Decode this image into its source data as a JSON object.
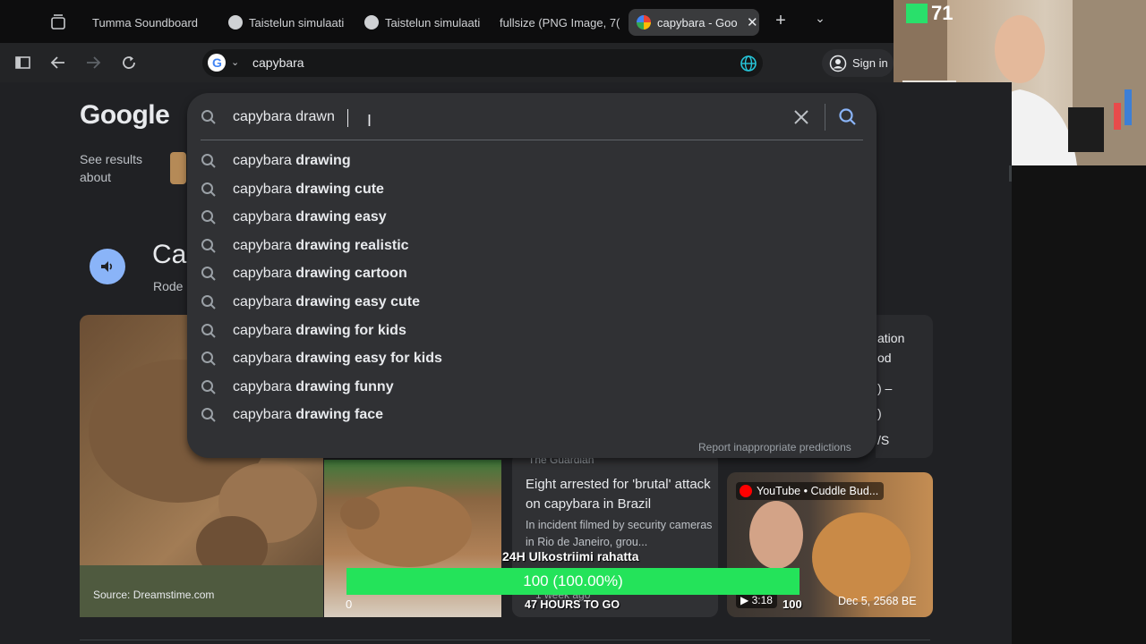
{
  "browser": {
    "tabs": [
      {
        "label": "Tumma Soundboard",
        "active": false
      },
      {
        "label": "Taistelun simulaati",
        "active": false
      },
      {
        "label": "Taistelun simulaati",
        "active": false
      },
      {
        "label": "fullsize (PNG Image, 7(",
        "active": false
      },
      {
        "label": "capybara - Goo",
        "active": true
      }
    ],
    "address": "capybara",
    "signin_label": "Sign in"
  },
  "webcam": {
    "score": "71"
  },
  "google": {
    "logo": "Google",
    "see_results": "See results about",
    "knowledge_title": "Ca",
    "knowledge_sub": "Rode",
    "search_query": "capybara drawn",
    "suggestions": [
      {
        "prefix": "capybara ",
        "bold": "drawing"
      },
      {
        "prefix": "capybara ",
        "bold": "drawing cute"
      },
      {
        "prefix": "capybara ",
        "bold": "drawing easy"
      },
      {
        "prefix": "capybara ",
        "bold": "drawing realistic"
      },
      {
        "prefix": "capybara ",
        "bold": "drawing cartoon"
      },
      {
        "prefix": "capybara ",
        "bold": "drawing easy cute"
      },
      {
        "prefix": "capybara ",
        "bold": "drawing for kids"
      },
      {
        "prefix": "capybara ",
        "bold": "drawing easy for kids"
      },
      {
        "prefix": "capybara ",
        "bold": "drawing funny"
      },
      {
        "prefix": "capybara ",
        "bold": "drawing face"
      }
    ],
    "report_label": "Report inappropriate predictions",
    "image_source": "Source: Dreamstime.com",
    "news": {
      "source": "The Guardian",
      "title": "Eight arrested for 'brutal' attack on capybara in Brazil",
      "description": "In incident filmed by security cameras in Rio de Janeiro, grou...",
      "age": "1 week ago"
    },
    "video": {
      "channel": "YouTube • Cuddle Bud...",
      "duration": "3:18",
      "date": "Dec 5, 2568 BE"
    },
    "side_snippets": [
      "ation",
      "od",
      ") –",
      ")",
      "/S"
    ]
  },
  "overlay": {
    "title": "24H Ulkostriimi rahatta",
    "progress_text": "100 (100.00%)",
    "progress_fraction": 1.0,
    "count": "100",
    "left_count": "0",
    "hours_left": "47 HOURS TO GO"
  },
  "colors": {
    "accent": "#24e35a",
    "link": "#8ab4f8",
    "bg": "#202124"
  }
}
